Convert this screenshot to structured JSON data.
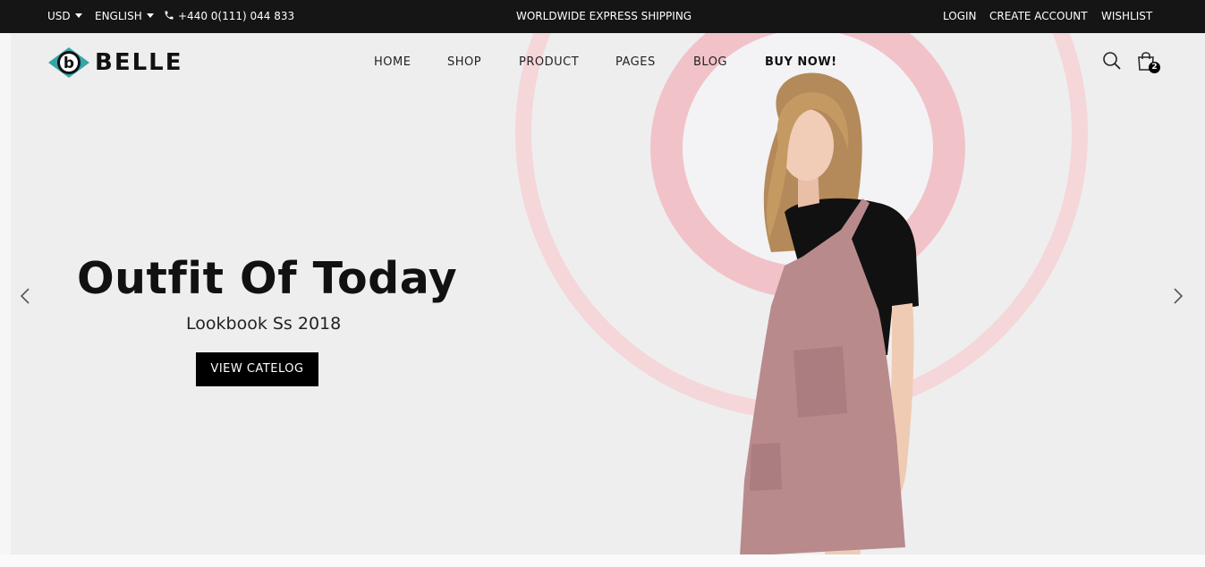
{
  "topbar": {
    "currency": "USD",
    "language": "ENGLISH",
    "phone": "+440 0(111) 044 833",
    "shipping": "WORLDWIDE EXPRESS SHIPPING",
    "links": {
      "login": "LOGIN",
      "create_account": "CREATE ACCOUNT",
      "wishlist": "WISHLIST"
    }
  },
  "header": {
    "logo_text": "BELLE",
    "nav": [
      {
        "label": "HOME"
      },
      {
        "label": "SHOP"
      },
      {
        "label": "PRODUCT"
      },
      {
        "label": "PAGES"
      },
      {
        "label": "BLOG"
      },
      {
        "label": "BUY NOW!"
      }
    ],
    "cart_count": "2",
    "icons": [
      "search-icon",
      "cart-icon"
    ]
  },
  "hero": {
    "title": "Outfit Of Today",
    "subtitle": "Lookbook Ss 2018",
    "cta_label": "VIEW CATELOG"
  },
  "colors": {
    "topbar_bg": "#151515",
    "hero_bg": "#eeeeef",
    "ring_pink": "#f1c3c8",
    "logo_teal": "#35a6a6",
    "dress_pink": "#b98a8c"
  }
}
